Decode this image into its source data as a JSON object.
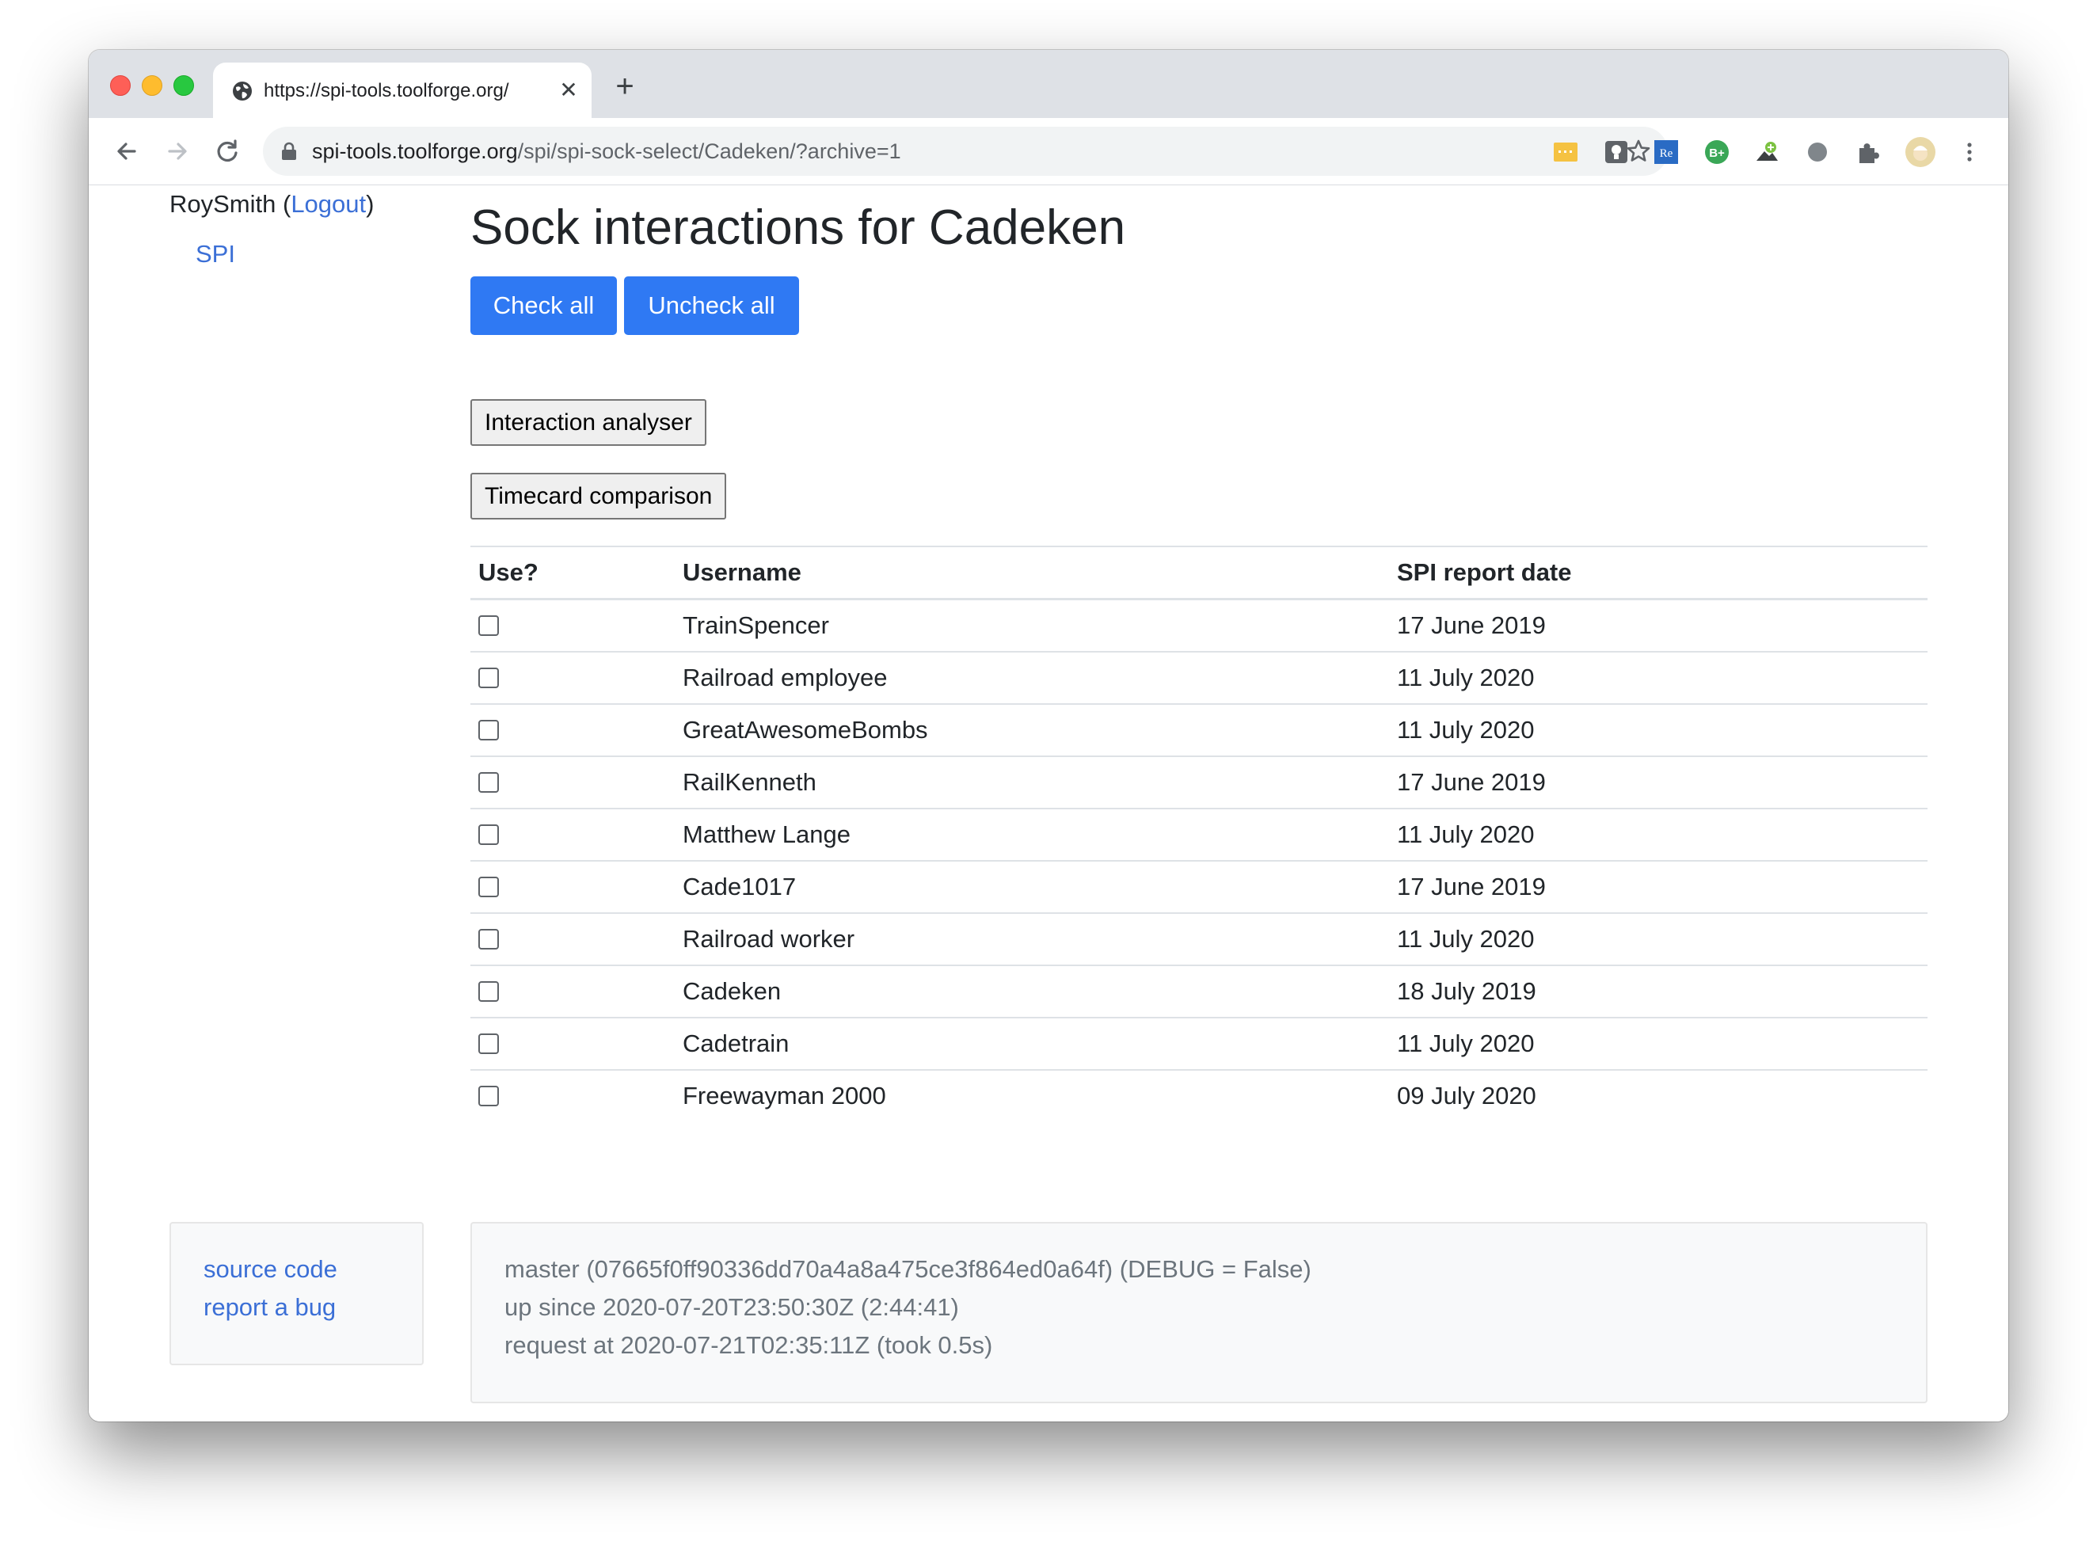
{
  "browser": {
    "tab_title": "https://spi-tools.toolforge.org/",
    "tab_close_glyph": "✕",
    "new_tab_glyph": "+",
    "url_host": "spi-tools.toolforge.org",
    "url_path": "/spi/spi-sock-select/Cadeken/?archive=1",
    "icons": [
      "back-icon",
      "forward-icon",
      "reload-icon",
      "lock-icon",
      "star-icon",
      "extension-icons",
      "puzzle-icon",
      "profile-avatar",
      "menu-icon"
    ]
  },
  "header": {
    "username": "RoySmith",
    "logout_label": "Logout",
    "spi_link": "SPI"
  },
  "main": {
    "title": "Sock interactions for Cadeken",
    "check_all": "Check all",
    "uncheck_all": "Uncheck all",
    "interaction_analyser": "Interaction analyser",
    "timecard_comparison": "Timecard comparison"
  },
  "table": {
    "headers": [
      "Use?",
      "Username",
      "SPI report date"
    ],
    "rows": [
      {
        "username": "TrainSpencer",
        "date": "17 June 2019",
        "checked": false
      },
      {
        "username": "Railroad employee",
        "date": "11 July 2020",
        "checked": false
      },
      {
        "username": "GreatAwesomeBombs",
        "date": "11 July 2020",
        "checked": false
      },
      {
        "username": "RailKenneth",
        "date": "17 June 2019",
        "checked": false
      },
      {
        "username": "Matthew Lange",
        "date": "11 July 2020",
        "checked": false
      },
      {
        "username": "Cade1017",
        "date": "17 June 2019",
        "checked": false
      },
      {
        "username": "Railroad worker",
        "date": "11 July 2020",
        "checked": false
      },
      {
        "username": "Cadeken",
        "date": "18 July 2019",
        "checked": false
      },
      {
        "username": "Cadetrain",
        "date": "11 July 2020",
        "checked": false
      },
      {
        "username": "Freewayman 2000",
        "date": "09 July 2020",
        "checked": false
      }
    ]
  },
  "footer": {
    "source_code": "source code",
    "report_bug": "report a bug",
    "line1": "master (07665f0ff90336dd70a4a8a475ce3f864ed0a64f) (DEBUG = False)",
    "line2": "up since 2020-07-20T23:50:30Z (2:44:41)",
    "line3": "request at 2020-07-21T02:35:11Z (took 0.5s)"
  },
  "colors": {
    "primary_button": "#2f79f3",
    "link": "#3b6fd6",
    "traffic_close": "#fe5f57",
    "traffic_min": "#febc2e",
    "traffic_max": "#28c840"
  }
}
